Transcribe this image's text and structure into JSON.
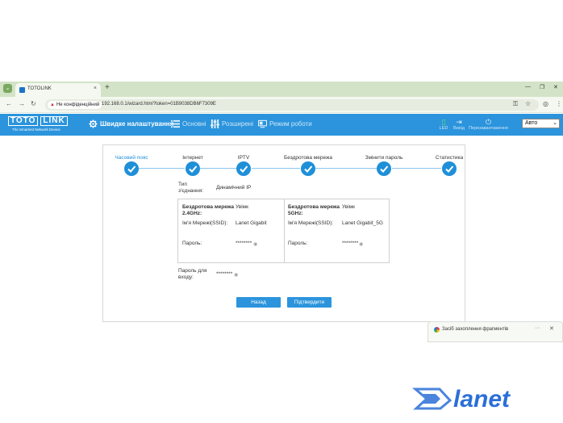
{
  "browser": {
    "tab_title": "TOTOLINK",
    "tab_close": "×",
    "new_tab": "+",
    "security_label": "Не конфіденційний",
    "url": "192.168.0.1/wizard.html?token=01B9038DB6F7309E"
  },
  "router": {
    "logo_left": "TOTO",
    "logo_right": "LINK",
    "logo_tagline": "The Smartest Network Device",
    "menu": [
      {
        "label": "Швидке налаштування",
        "icon": "gear-icon"
      },
      {
        "label": "Основні",
        "icon": "list-icon"
      },
      {
        "label": "Розширені",
        "icon": "sliders-icon"
      },
      {
        "label": "Режим роботи",
        "icon": "monitor-icon"
      }
    ],
    "right_actions": [
      {
        "label": "LED",
        "icon": "led-icon"
      },
      {
        "label": "Вихід",
        "icon": "logout-icon"
      },
      {
        "label": "Перезавантаження",
        "icon": "power-icon"
      }
    ],
    "language": "Авто"
  },
  "wizard": {
    "steps": [
      {
        "label": "Часовий пояс",
        "active": true
      },
      {
        "label": "Інтернет"
      },
      {
        "label": "IPTV"
      },
      {
        "label": "Бездротова мережа"
      },
      {
        "label": "Змінити пароль"
      },
      {
        "label": "Статистика"
      }
    ],
    "conn_type_label_1": "Тип",
    "conn_type_label_2": "з'єднання:",
    "conn_type_value": "Динамічний IP",
    "wifi24": {
      "title_1": "Бездротова мережа",
      "title_2": "2.4GHz:",
      "state": "Увімк",
      "ssid_label": "Ім'я Мережі(SSID):",
      "ssid": "Lanet Gigabit",
      "pass_label": "Пароль:",
      "pass": "********"
    },
    "wifi5": {
      "title_1": "Бездротова мережа",
      "title_2": "5GHz:",
      "state": "Увімк",
      "ssid_label": "Ім'я Мережі(SSID):",
      "ssid": "Lanet Gigabit_5G",
      "pass_label": "Пароль:",
      "pass": "********"
    },
    "login_pass_label_1": "Пароль для",
    "login_pass_label_2": "входу:",
    "login_pass": "********",
    "back_button": "Назад",
    "confirm_button": "Підтвердити"
  },
  "snip_popup": {
    "title": "Засіб захоплення фрагментів",
    "more": "···",
    "close": "✕"
  },
  "watermark": "lanet",
  "colors": {
    "header": "#2b94dc",
    "step": "#1f8fd8",
    "tab_strip": "#d3e3c7",
    "brand": "#2b6fd8"
  }
}
